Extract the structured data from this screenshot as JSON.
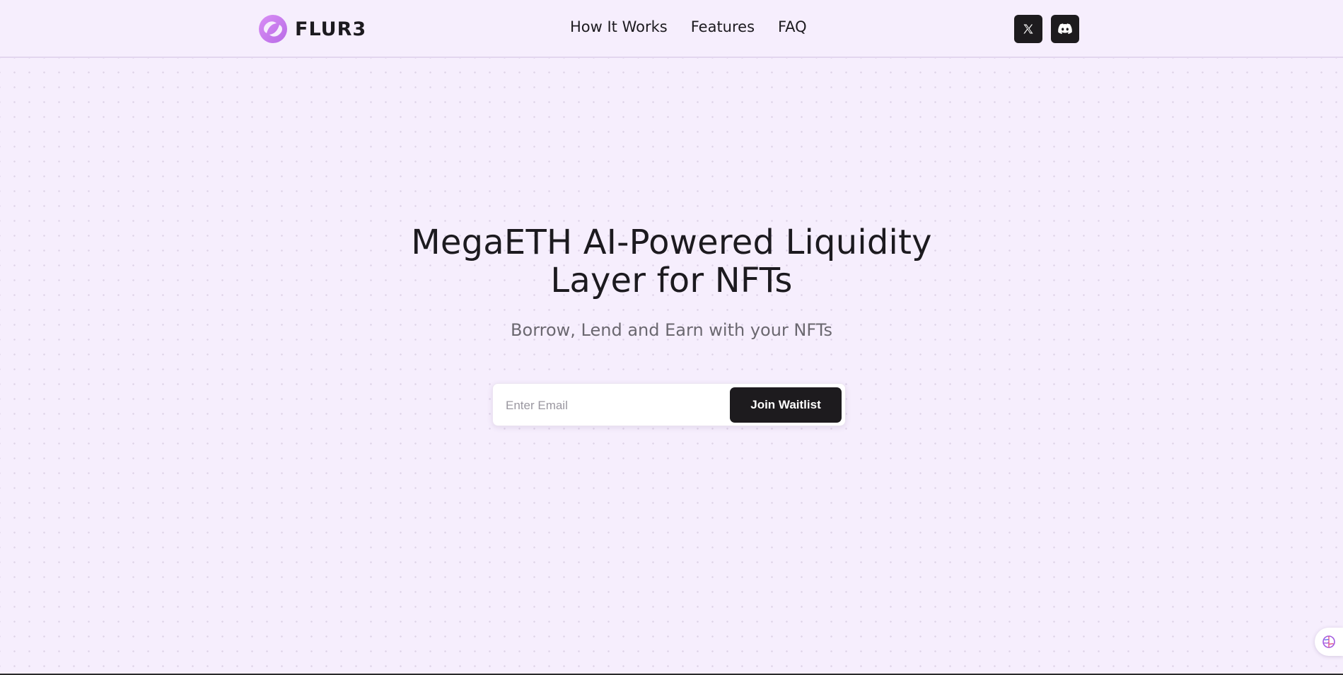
{
  "header": {
    "brand": "FLUR3",
    "nav": [
      {
        "label": "How It Works"
      },
      {
        "label": "Features"
      },
      {
        "label": "FAQ"
      }
    ],
    "social": [
      {
        "icon": "x-icon"
      },
      {
        "icon": "discord-icon"
      }
    ]
  },
  "hero": {
    "title_line1": "MegaETH AI-Powered Liquidity",
    "title_line2": "Layer for NFTs",
    "subtitle": "Borrow, Lend and Earn with your NFTs"
  },
  "waitlist": {
    "email_placeholder": "Enter Email",
    "email_value": "",
    "button_label": "Join Waitlist"
  },
  "colors": {
    "background": "#f6eefd",
    "accent": "#c87ef0",
    "button": "#1d1b1e"
  },
  "widget": {
    "icon": "brain-icon"
  }
}
